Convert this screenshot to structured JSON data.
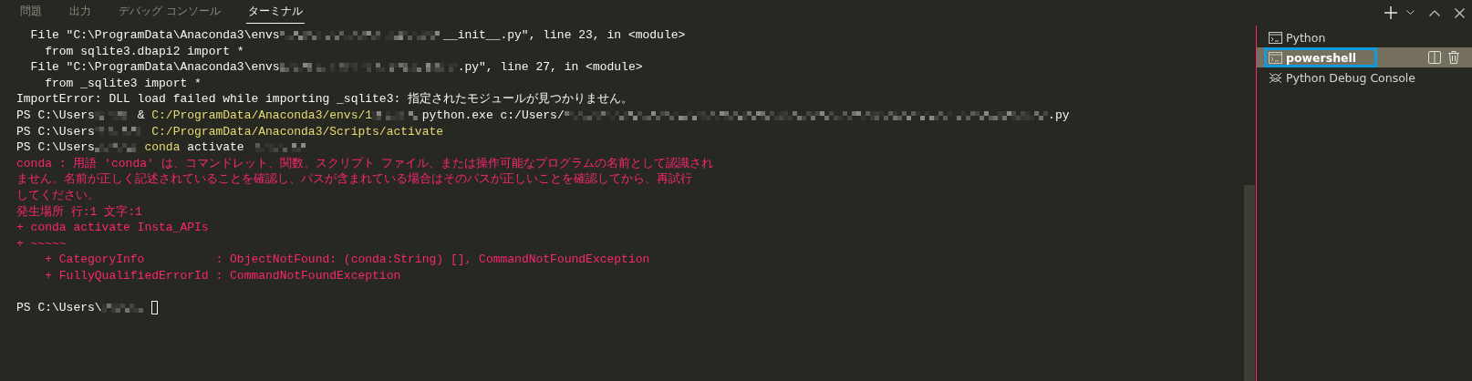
{
  "tabs": [
    {
      "label": "問題",
      "selected": false
    },
    {
      "label": "出力",
      "selected": false
    },
    {
      "label": "デバッグ コンソール",
      "selected": false
    },
    {
      "label": "ターミナル",
      "selected": true
    }
  ],
  "terminal_output": [
    {
      "segments": [
        {
          "kind": "plain",
          "text": "  File \"C:\\ProgramData\\Anaconda3\\envs"
        },
        {
          "kind": "redacted"
        },
        {
          "kind": "plain",
          "text": "__init__.py\", line 23, in <module>"
        }
      ]
    },
    {
      "segments": [
        {
          "kind": "plain",
          "text": "    from sqlite3.dbapi2 import *"
        }
      ]
    },
    {
      "segments": [
        {
          "kind": "plain",
          "text": "  File \"C:\\ProgramData\\Anaconda3\\envs"
        },
        {
          "kind": "redacted"
        },
        {
          "kind": "plain",
          "text": ".py\", line 27, in <module>"
        }
      ]
    },
    {
      "segments": [
        {
          "kind": "plain",
          "text": "    from _sqlite3 import *"
        }
      ]
    },
    {
      "segments": [
        {
          "kind": "plain",
          "text": "ImportError: DLL load failed while importing _sqlite3: 指定されたモジュールが見つかりません。"
        }
      ]
    },
    {
      "segments": [
        {
          "kind": "plain",
          "text": "PS C:\\Users"
        },
        {
          "kind": "redacted"
        },
        {
          "kind": "plain",
          "text": " & "
        },
        {
          "kind": "command",
          "text": "C:/ProgramData/Anaconda3/envs/1"
        },
        {
          "kind": "redacted"
        },
        {
          "kind": "plain",
          "text": "python.exe c:/Users/"
        },
        {
          "kind": "redacted"
        },
        {
          "kind": "plain",
          "text": ".py"
        }
      ]
    },
    {
      "segments": [
        {
          "kind": "plain",
          "text": "PS C:\\Users"
        },
        {
          "kind": "redacted"
        },
        {
          "kind": "command",
          "text": " C:/ProgramData/Anaconda3/Scripts/activate"
        }
      ]
    },
    {
      "segments": [
        {
          "kind": "plain",
          "text": "PS C:\\Users"
        },
        {
          "kind": "redacted"
        },
        {
          "kind": "command",
          "text": " conda"
        },
        {
          "kind": "plain",
          "text": " activate "
        },
        {
          "kind": "redacted"
        }
      ]
    },
    {
      "segments": [
        {
          "kind": "error",
          "text": "conda : 用語 'conda' は、コマンドレット、関数、スクリプト ファイル、または操作可能なプログラムの名前として認識され"
        }
      ]
    },
    {
      "segments": [
        {
          "kind": "error",
          "text": "ません。名前が正しく記述されていることを確認し、パスが含まれている場合はそのパスが正しいことを確認してから、再試行"
        }
      ]
    },
    {
      "segments": [
        {
          "kind": "error",
          "text": "してください。"
        }
      ]
    },
    {
      "segments": [
        {
          "kind": "error",
          "text": "発生場所 行:1 文字:1"
        }
      ]
    },
    {
      "segments": [
        {
          "kind": "error",
          "text": "+ conda activate Insta_APIs"
        }
      ]
    },
    {
      "segments": [
        {
          "kind": "error",
          "text": "+ ~~~~~"
        }
      ]
    },
    {
      "segments": [
        {
          "kind": "error",
          "text": "    + CategoryInfo          : ObjectNotFound: (conda:String) [], CommandNotFoundException"
        }
      ]
    },
    {
      "segments": [
        {
          "kind": "error",
          "text": "    + FullyQualifiedErrorId : CommandNotFoundException"
        }
      ]
    },
    {
      "kind": "blank"
    },
    {
      "segments": [
        {
          "kind": "plain",
          "text": "PS C:\\Users\\"
        },
        {
          "kind": "redacted"
        },
        {
          "kind": "cursor"
        }
      ]
    }
  ],
  "terminals": [
    {
      "name": "Python",
      "kind": "shell",
      "selected": false
    },
    {
      "name": "powershell",
      "kind": "shell",
      "selected": true
    },
    {
      "name": "Python Debug Console",
      "kind": "debug",
      "selected": false
    }
  ]
}
